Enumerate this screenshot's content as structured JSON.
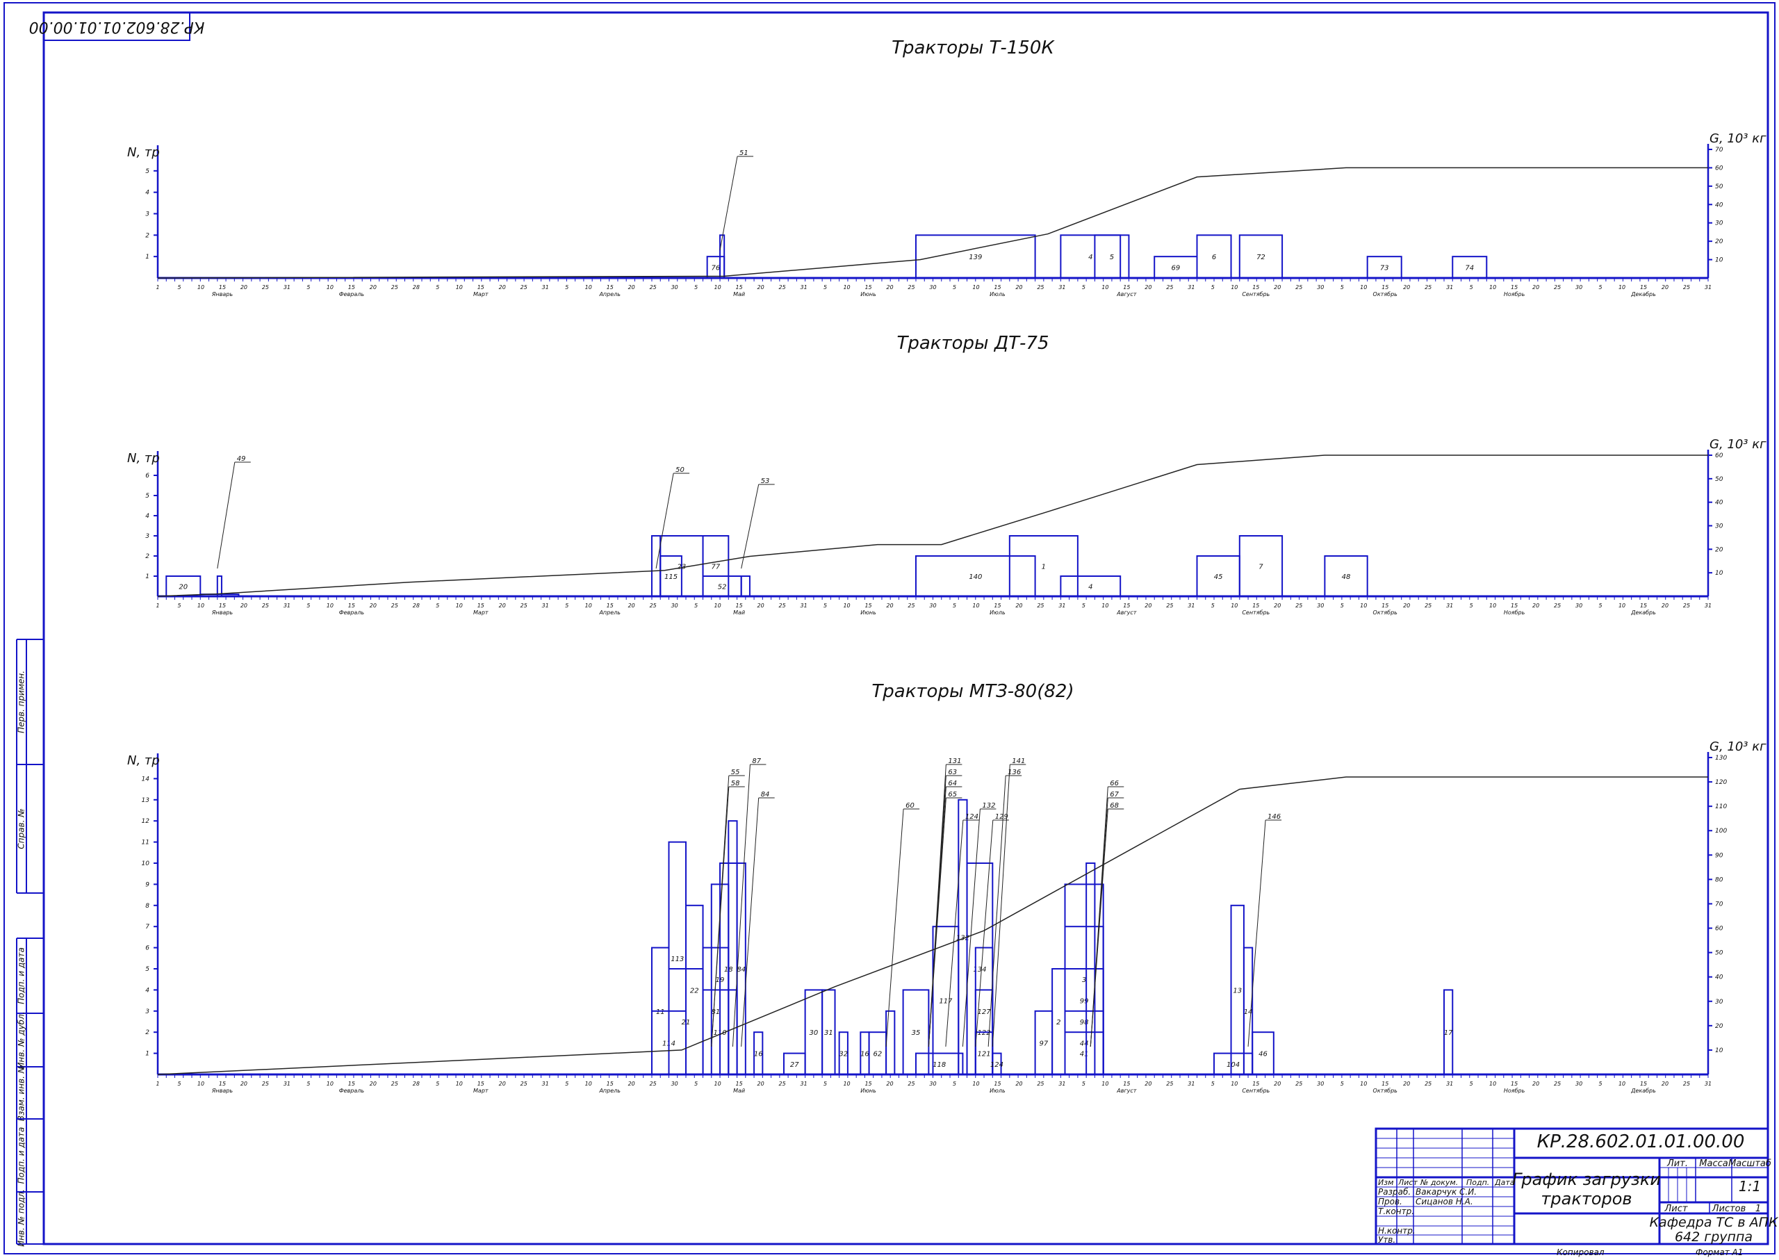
{
  "sheet": {
    "code": "КР.28.602.01.01.00.00",
    "code_inverted": "КР.28.602.01.01.00.00",
    "ink_color": "#1414c8",
    "line_color": "#222222"
  },
  "side_stamp": [
    "Перв. примен.",
    "Справ. №",
    "Подп. и дата",
    "Инв. № дубл.",
    "Взам. инв. №",
    "Подп. и дата",
    "Инв. № подл."
  ],
  "months": [
    "Январь",
    "Февраль",
    "Март",
    "Апрель",
    "Май",
    "Июнь",
    "Июль",
    "Август",
    "Сентябрь",
    "Октябрь",
    "Ноябрь",
    "Декабрь"
  ],
  "day_ticks": [
    "1",
    "5",
    "10",
    "15",
    "20",
    "25",
    "31",
    "5",
    "10",
    "15",
    "20",
    "25",
    "28",
    "5",
    "10",
    "15",
    "20",
    "25",
    "31",
    "5",
    "10",
    "15",
    "20",
    "25",
    "30",
    "5",
    "10",
    "15",
    "20",
    "25",
    "31",
    "5",
    "10",
    "15",
    "20",
    "25",
    "30",
    "5",
    "10",
    "15",
    "20",
    "25",
    "31",
    "5",
    "10",
    "15",
    "20",
    "25",
    "31",
    "5",
    "10",
    "15",
    "20",
    "25",
    "30",
    "5",
    "10",
    "15",
    "20",
    "25",
    "31",
    "5",
    "10",
    "15",
    "20",
    "25",
    "30",
    "5",
    "10",
    "15",
    "20",
    "25",
    "31"
  ],
  "chart_data": [
    {
      "type": "bar",
      "title": "Тракторы Т-150К",
      "ylabel": "N, тр",
      "y2label": "G, 10³ кг",
      "ylim": [
        0,
        6
      ],
      "y2lim": [
        0,
        70
      ],
      "yticks": [
        1,
        2,
        3,
        4,
        5
      ],
      "y2ticks": [
        10,
        20,
        30,
        40,
        50,
        60,
        70
      ],
      "bars": [
        {
          "start": 130,
          "end": 134,
          "value": 1,
          "label": "76"
        },
        {
          "start": 133,
          "end": 134,
          "value": 2,
          "label": ""
        },
        {
          "start": 179,
          "end": 207,
          "value": 2,
          "label": "139"
        },
        {
          "start": 213,
          "end": 227,
          "value": 2,
          "label": "4"
        },
        {
          "start": 221,
          "end": 229,
          "value": 2,
          "label": "5"
        },
        {
          "start": 235,
          "end": 245,
          "value": 1,
          "label": "69"
        },
        {
          "start": 245,
          "end": 253,
          "value": 2,
          "label": "6"
        },
        {
          "start": 255,
          "end": 265,
          "value": 2,
          "label": "72"
        },
        {
          "start": 285,
          "end": 293,
          "value": 1,
          "label": "73"
        },
        {
          "start": 305,
          "end": 313,
          "value": 1,
          "label": "74"
        }
      ],
      "callouts": [
        {
          "label": "51",
          "day": 133
        }
      ],
      "cumulative_line": {
        "x": [
          1,
          134,
          180,
          210,
          245,
          280,
          365
        ],
        "y": [
          0,
          1,
          10,
          24,
          55,
          60,
          60
        ]
      }
    },
    {
      "type": "bar",
      "title": "Тракторы ДТ-75",
      "ylabel": "N, тр",
      "y2label": "G, 10³ кг",
      "ylim": [
        0,
        7
      ],
      "y2lim": [
        0,
        60
      ],
      "yticks": [
        1,
        2,
        3,
        4,
        5,
        6
      ],
      "y2ticks": [
        10,
        20,
        30,
        40,
        50,
        60
      ],
      "bars": [
        {
          "start": 3,
          "end": 11,
          "value": 1,
          "label": "20"
        },
        {
          "start": 11,
          "end": 20,
          "value": 0.1,
          "label": ""
        },
        {
          "start": 15,
          "end": 16,
          "value": 1,
          "label": ""
        },
        {
          "start": 117,
          "end": 119,
          "value": 3,
          "label": ""
        },
        {
          "start": 119,
          "end": 124,
          "value": 2,
          "label": "115"
        },
        {
          "start": 119,
          "end": 129,
          "value": 3,
          "label": "23"
        },
        {
          "start": 129,
          "end": 135,
          "value": 3,
          "label": "77"
        },
        {
          "start": 129,
          "end": 138,
          "value": 1,
          "label": "52"
        },
        {
          "start": 138,
          "end": 140,
          "value": 1,
          "label": ""
        },
        {
          "start": 179,
          "end": 207,
          "value": 2,
          "label": "140"
        },
        {
          "start": 201,
          "end": 217,
          "value": 3,
          "label": "1"
        },
        {
          "start": 213,
          "end": 227,
          "value": 1,
          "label": "4"
        },
        {
          "start": 245,
          "end": 255,
          "value": 2,
          "label": "45"
        },
        {
          "start": 255,
          "end": 265,
          "value": 3,
          "label": "7"
        },
        {
          "start": 275,
          "end": 285,
          "value": 2,
          "label": "48"
        }
      ],
      "callouts": [
        {
          "label": "49",
          "day": 15
        },
        {
          "label": "50",
          "day": 118
        },
        {
          "label": "53",
          "day": 138
        }
      ],
      "cumulative_line": {
        "x": [
          1,
          15,
          60,
          120,
          140,
          170,
          185,
          210,
          245,
          275,
          365
        ],
        "y": [
          0,
          1,
          6,
          11,
          17,
          22,
          22,
          36,
          56,
          60,
          60
        ]
      }
    },
    {
      "type": "bar",
      "title": "Тракторы МТЗ-80(82)",
      "ylabel": "N, тр",
      "y2label": "G, 10³ кг",
      "ylim": [
        0,
        15
      ],
      "y2lim": [
        0,
        130
      ],
      "yticks": [
        1,
        2,
        3,
        4,
        5,
        6,
        7,
        8,
        9,
        10,
        11,
        12,
        13,
        14
      ],
      "y2ticks": [
        10,
        20,
        30,
        40,
        50,
        60,
        70,
        80,
        90,
        100,
        110,
        120,
        130
      ],
      "bars": [
        {
          "start": 117,
          "end": 121,
          "value": 6,
          "label": "11"
        },
        {
          "start": 117,
          "end": 125,
          "value": 3,
          "label": "114"
        },
        {
          "start": 121,
          "end": 125,
          "value": 11,
          "label": "113"
        },
        {
          "start": 121,
          "end": 129,
          "value": 5,
          "label": "21"
        },
        {
          "start": 125,
          "end": 129,
          "value": 8,
          "label": "22"
        },
        {
          "start": 129,
          "end": 137,
          "value": 4,
          "label": "110"
        },
        {
          "start": 129,
          "end": 135,
          "value": 6,
          "label": "81"
        },
        {
          "start": 131,
          "end": 135,
          "value": 9,
          "label": "19"
        },
        {
          "start": 133,
          "end": 137,
          "value": 10,
          "label": "18"
        },
        {
          "start": 135,
          "end": 137,
          "value": 12,
          "label": ""
        },
        {
          "start": 137,
          "end": 139,
          "value": 10,
          "label": "84"
        },
        {
          "start": 141,
          "end": 143,
          "value": 2,
          "label": "16"
        },
        {
          "start": 148,
          "end": 153,
          "value": 1,
          "label": "27"
        },
        {
          "start": 153,
          "end": 157,
          "value": 4,
          "label": "30"
        },
        {
          "start": 157,
          "end": 160,
          "value": 4,
          "label": "31"
        },
        {
          "start": 161,
          "end": 163,
          "value": 2,
          "label": "32"
        },
        {
          "start": 166,
          "end": 168,
          "value": 2,
          "label": "16"
        },
        {
          "start": 168,
          "end": 172,
          "value": 2,
          "label": "62"
        },
        {
          "start": 172,
          "end": 174,
          "value": 3,
          "label": ""
        },
        {
          "start": 176,
          "end": 182,
          "value": 4,
          "label": "35"
        },
        {
          "start": 179,
          "end": 190,
          "value": 1,
          "label": "118"
        },
        {
          "start": 183,
          "end": 189,
          "value": 7,
          "label": "117"
        },
        {
          "start": 189,
          "end": 191,
          "value": 13,
          "label": "132"
        },
        {
          "start": 191,
          "end": 197,
          "value": 10,
          "label": "134"
        },
        {
          "start": 193,
          "end": 197,
          "value": 6,
          "label": "127"
        },
        {
          "start": 193,
          "end": 197,
          "value": 4,
          "label": "122"
        },
        {
          "start": 193,
          "end": 197,
          "value": 2,
          "label": "121"
        },
        {
          "start": 197,
          "end": 199,
          "value": 1,
          "label": "124"
        },
        {
          "start": 207,
          "end": 211,
          "value": 3,
          "label": "97"
        },
        {
          "start": 211,
          "end": 214,
          "value": 5,
          "label": "2"
        },
        {
          "start": 214,
          "end": 223,
          "value": 9,
          "label": "3"
        },
        {
          "start": 214,
          "end": 223,
          "value": 7,
          "label": "99"
        },
        {
          "start": 214,
          "end": 223,
          "value": 5,
          "label": "98"
        },
        {
          "start": 214,
          "end": 223,
          "value": 3,
          "label": "44"
        },
        {
          "start": 214,
          "end": 223,
          "value": 2,
          "label": "41"
        },
        {
          "start": 219,
          "end": 221,
          "value": 10,
          "label": ""
        },
        {
          "start": 249,
          "end": 258,
          "value": 1,
          "label": "104"
        },
        {
          "start": 253,
          "end": 256,
          "value": 8,
          "label": "13"
        },
        {
          "start": 256,
          "end": 258,
          "value": 6,
          "label": "14"
        },
        {
          "start": 258,
          "end": 263,
          "value": 2,
          "label": "46"
        },
        {
          "start": 303,
          "end": 305,
          "value": 4,
          "label": "17"
        }
      ],
      "callouts": [
        {
          "label": "87",
          "day": 136
        },
        {
          "label": "55",
          "day": 131
        },
        {
          "label": "58",
          "day": 131
        },
        {
          "label": "84",
          "day": 138
        },
        {
          "label": "132",
          "day": 190
        },
        {
          "label": "124",
          "day": 186
        },
        {
          "label": "131",
          "day": 182
        },
        {
          "label": "63",
          "day": 182
        },
        {
          "label": "64",
          "day": 182
        },
        {
          "label": "65",
          "day": 182
        },
        {
          "label": "60",
          "day": 172
        },
        {
          "label": "129",
          "day": 193
        },
        {
          "label": "141",
          "day": 197
        },
        {
          "label": "136",
          "day": 196
        },
        {
          "label": "66",
          "day": 220
        },
        {
          "label": "67",
          "day": 220
        },
        {
          "label": "68",
          "day": 220
        },
        {
          "label": "146",
          "day": 257
        }
      ],
      "cumulative_line": {
        "x": [
          1,
          124,
          160,
          195,
          255,
          280,
          365
        ],
        "y": [
          0,
          10,
          36,
          59,
          117,
          122,
          122
        ]
      }
    }
  ],
  "stamp": {
    "doc_code": "КР.28.602.01.01.00.00",
    "title_line1": "График загрузки",
    "title_line2": "тракторов",
    "col_izm": "Изм",
    "col_list": "Лист",
    "col_ndoc": "№ докум.",
    "col_podp": "Подп.",
    "col_data": "Дата",
    "row_razrab": "Разраб.",
    "razrab_name": "Вакарчук С.И.",
    "row_prov": "Пров.",
    "prov_name": "Сицанов Н.А.",
    "row_tkontr": "Т.контр.",
    "row_nkontr": "Н.контр.",
    "row_utv": "Утв.",
    "lit_label": "Лит.",
    "massa_label": "Масса",
    "masshtab_label": "Масштаб",
    "scale_value": "1:1",
    "list_label": "Лист",
    "listov_label": "Листов",
    "listov_value": "1",
    "org_line1": "Кафедра ТС в АПК",
    "org_line2": "642 группа",
    "kopiroval": "Копировал",
    "format": "Формат  А1"
  }
}
